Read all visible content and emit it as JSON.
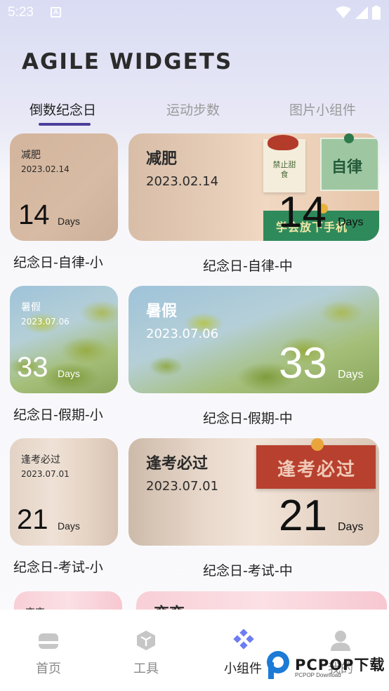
{
  "status_bar": {
    "time": "5:23",
    "notif_letter": "A"
  },
  "app_title": "AGILE WIDGETS",
  "tabs": [
    {
      "label": "倒数纪念日",
      "active": true
    },
    {
      "label": "运动步数",
      "active": false
    },
    {
      "label": "图片小组件",
      "active": false
    }
  ],
  "widgets": [
    {
      "small": {
        "title": "减肥",
        "date": "2023.02.14",
        "count": "14",
        "unit": "Days"
      },
      "medium": {
        "title": "减肥",
        "date": "2023.02.14",
        "count": "14",
        "unit": "Days",
        "deco_text": "学会放下手机",
        "note_left": "禁止甜食",
        "note_right": "自律"
      },
      "small_caption": "纪念日-自律-小",
      "medium_caption": "纪念日-自律-中"
    },
    {
      "small": {
        "title": "暑假",
        "date": "2023.07.06",
        "count": "33",
        "unit": "Days"
      },
      "medium": {
        "title": "暑假",
        "date": "2023.07.06",
        "count": "33",
        "unit": "Days"
      },
      "small_caption": "纪念日-假期-小",
      "medium_caption": "纪念日-假期-中"
    },
    {
      "small": {
        "title": "逢考必过",
        "date": "2023.07.01",
        "count": "21",
        "unit": "Days"
      },
      "medium": {
        "title": "逢考必过",
        "date": "2023.07.01",
        "count": "21",
        "unit": "Days",
        "deco_text": "逢考必过"
      },
      "small_caption": "纪念日-考试-小",
      "medium_caption": "纪念日-考试-中"
    },
    {
      "small": {
        "title": "恋恋"
      },
      "medium": {
        "title": "恋恋"
      }
    }
  ],
  "bottom_nav": [
    {
      "label": "首页",
      "icon": "home-icon",
      "active": false
    },
    {
      "label": "工具",
      "icon": "cube-icon",
      "active": false
    },
    {
      "label": "小组件",
      "icon": "widgets-diamond-icon",
      "active": true
    },
    {
      "label": "我的",
      "icon": "person-icon",
      "active": false
    }
  ],
  "watermark": {
    "brand": "PCPOP下载",
    "sub": "PCPOP Download"
  },
  "colors": {
    "accent": "#4b3f9b",
    "active_icon": "#6c7cf2"
  }
}
